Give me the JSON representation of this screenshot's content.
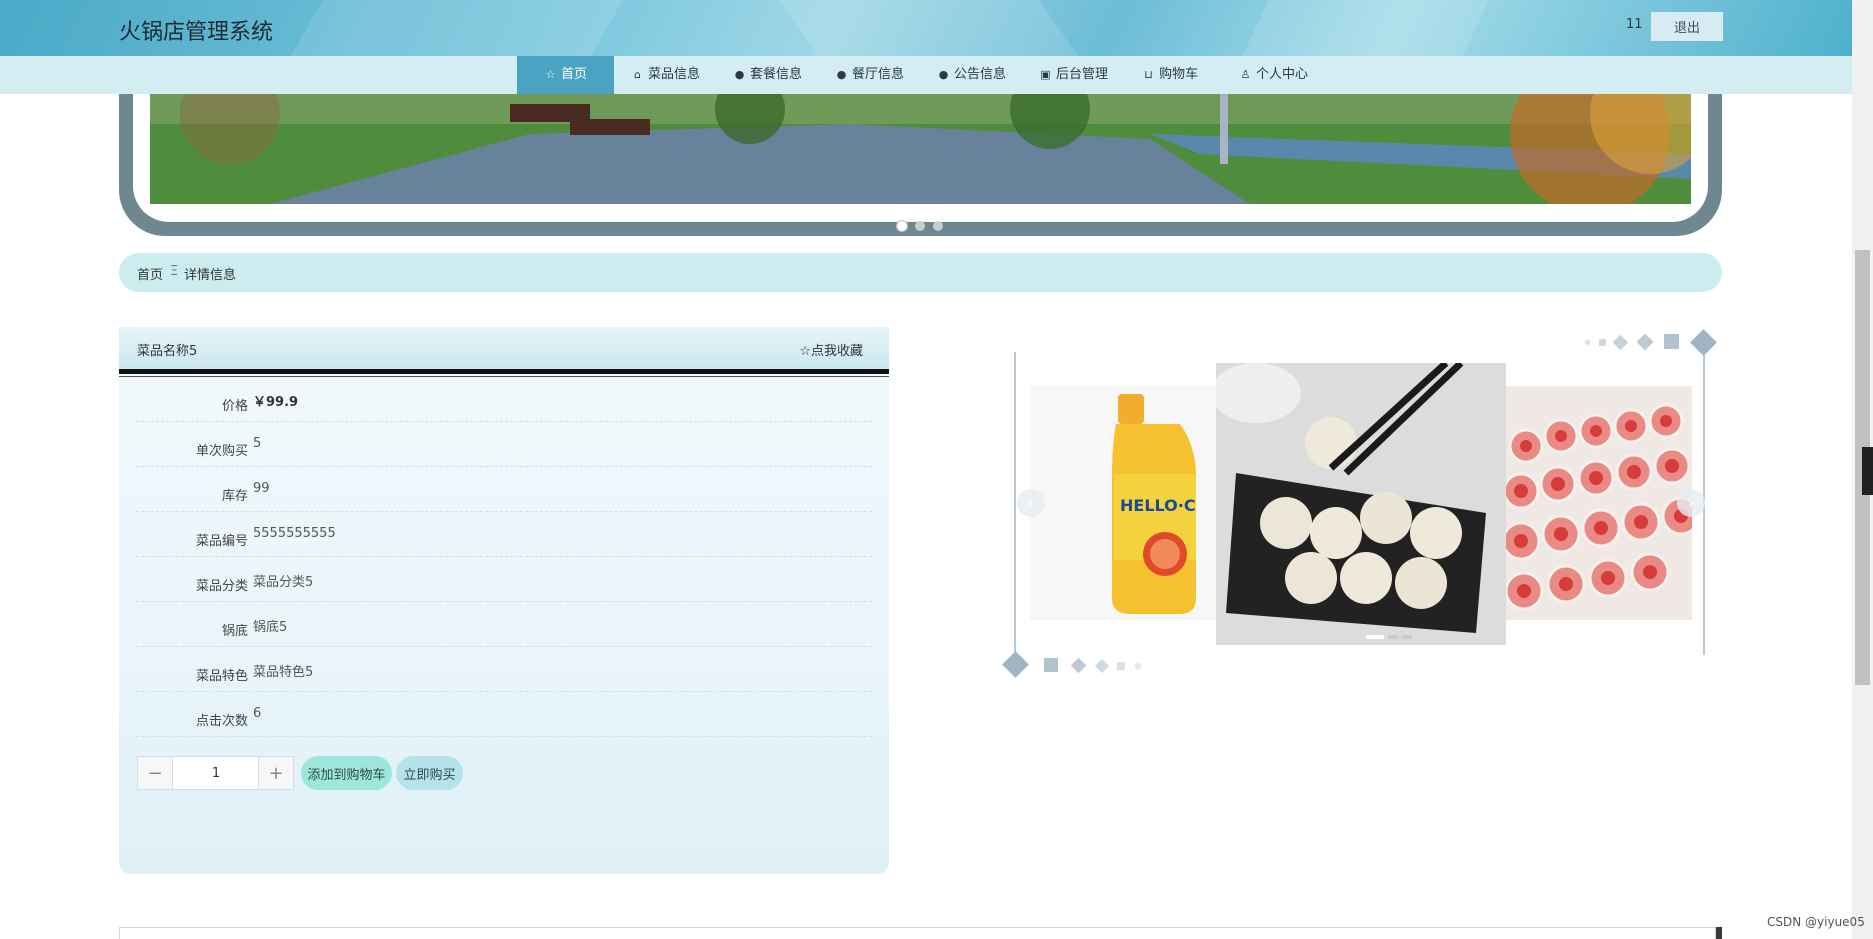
{
  "header": {
    "title": "火锅店管理系统",
    "user_badge": "11",
    "logout_label": "退出"
  },
  "nav": {
    "items": [
      {
        "label": "首页",
        "icon": "star-icon",
        "active": true
      },
      {
        "label": "菜品信息",
        "icon": "bag-icon"
      },
      {
        "label": "套餐信息",
        "icon": "info-icon"
      },
      {
        "label": "餐厅信息",
        "icon": "question-icon"
      },
      {
        "label": "公告信息",
        "icon": "info-icon"
      },
      {
        "label": "后台管理",
        "icon": "gift-icon"
      },
      {
        "label": "购物车",
        "icon": "cart-icon"
      },
      {
        "label": "个人中心",
        "icon": "user-icon"
      }
    ]
  },
  "banner": {
    "slide_count": 3,
    "active_slide": 1
  },
  "breadcrumb": {
    "home": "首页",
    "separator": "Ξ",
    "current": "详情信息"
  },
  "detail": {
    "title": "菜品名称5",
    "favorite_label": "☆点我收藏",
    "fields": [
      {
        "label": "价格",
        "value": "￥99.9"
      },
      {
        "label": "单次购买",
        "value": "5"
      },
      {
        "label": "库存",
        "value": "99"
      },
      {
        "label": "菜品编号",
        "value": "5555555555"
      },
      {
        "label": "菜品分类",
        "value": "菜品分类5"
      },
      {
        "label": "锅底",
        "value": "锅底5"
      },
      {
        "label": "菜品特色",
        "value": "菜品特色5"
      },
      {
        "label": "点击次数",
        "value": "6"
      }
    ],
    "quantity": "1",
    "minus_label": "−",
    "plus_label": "+",
    "add_to_cart_label": "添加到购物车",
    "buy_now_label": "立即购买"
  },
  "carousel": {
    "prev_label": "‹",
    "next_label": "›",
    "bottle_text": "HELLO·C"
  },
  "watermark": "CSDN @yiyue05",
  "colors": {
    "accent": "#4aa3c3",
    "nav_bg": "#d3edf3",
    "breadcrumb_bg": "#ccecf0",
    "cart_btn": "#9ee6dc",
    "buy_btn": "#b6e3ea"
  }
}
